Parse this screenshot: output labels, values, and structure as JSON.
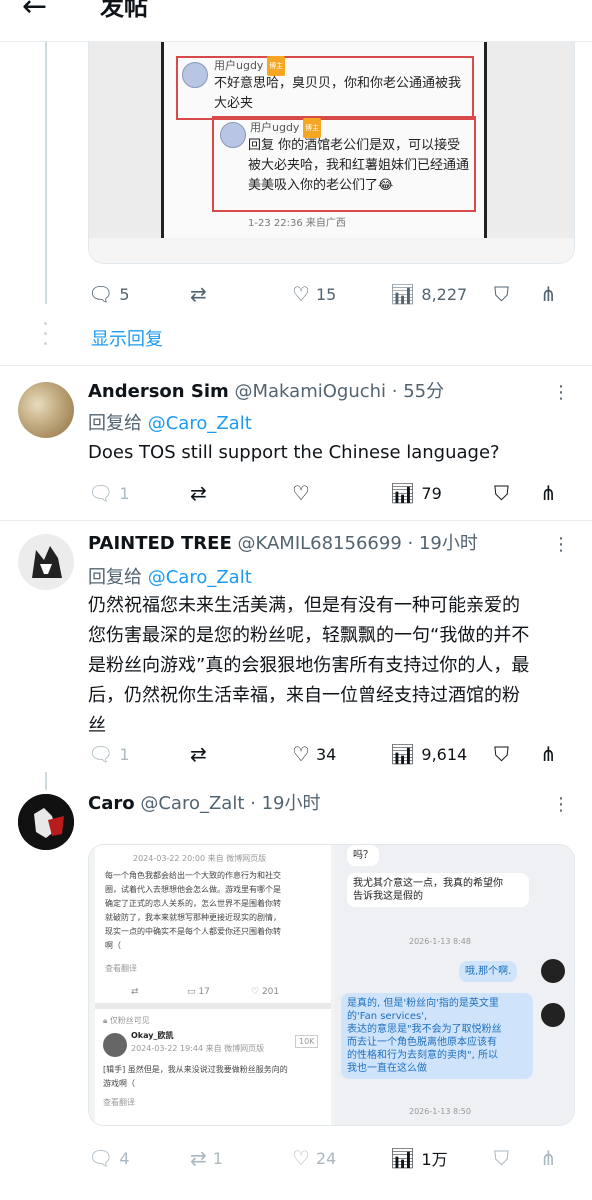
{
  "header": {
    "back_icon": "←",
    "title": "发帖"
  },
  "image1": {
    "user1": "用户ugdy",
    "badge": "博主",
    "text1": "不好意思哈，臭贝贝，你和你老公通通被我大必夹",
    "user2": "用户ugdy",
    "text2": "回复      你的酒馆老公们是双，可以接受被大必夹哈，我和红薯姐妹们已经通通美美吸入你的老公们了😂",
    "meta": "1-23 22:36 来自广西"
  },
  "tweet0_actions": {
    "replies": "5",
    "retweets": "",
    "likes": "15",
    "views": "8,227"
  },
  "show_replies": "显示回复",
  "tweets": [
    {
      "name": "Anderson Sim",
      "handle": "@MakamiOguchi",
      "time": "· 55分",
      "reply_prefix": "回复给",
      "reply_to": "@Caro_Zalt",
      "text": "Does TOS still support the Chinese language?",
      "replies": "1",
      "retweets": "",
      "likes": "",
      "views": "79"
    },
    {
      "name": "PAINTED TREE",
      "handle": "@KAMIL68156699",
      "time": "· 19小时",
      "reply_prefix": "回复给",
      "reply_to": "@Caro_Zalt",
      "text_lines": [
        "仍然祝福您未来生活美满，但是有没有一种可能亲爱的",
        "您伤害最深的是您的粉丝呢，轻飘飘的一句“我做的并不",
        "是粉丝向游戏”真的会狠狠地伤害所有支持过你的人，最",
        "后，仍然祝你生活幸福，来自一位曾经支持过酒馆的粉",
        "丝"
      ],
      "replies": "1",
      "retweets": "",
      "likes": "34",
      "views": "9,614"
    },
    {
      "name": "Caro",
      "handle": "@Caro_Zalt",
      "time": "· 19小时",
      "replies": "4",
      "retweets": "1",
      "likes": "24",
      "views": "1万"
    }
  ],
  "image2": {
    "left_ts": "2024-03-22 20:00 来自 微博网页版",
    "left_lines": [
      "每一个角色我都会给出一个大致的作息行为和社交",
      "圈，试着代入去想想他会怎么做。游戏里有哪个是",
      "确定了正式的恋人关系的，怎么世界不是围着你转",
      "就破防了，我本来就想写那种更接近现实的剧情，",
      "现实一点的中确实不是每个人都爱你还只围着你转",
      "啊（"
    ],
    "left_more": "查看翻译",
    "left_counts": {
      "forward": "",
      "comment": "17",
      "like": "201"
    },
    "fan_only": "仅粉丝可见",
    "okay_name": "Okay_欧凯",
    "okay_ts": "2024-03-22 19:44 来自 微博网页版",
    "okay_text": [
      "[辑手] 虽然但是，我从来没说过我要做粉丝服务向的",
      "游戏啊（"
    ],
    "okay_more": "查看翻译",
    "okay_follow": "10K",
    "r_q": "吗？",
    "r_bubble1": [
      "我尤其介意这一点，我真的希望你",
      "告诉我这是假的"
    ],
    "r_ts1": "2026-1-13 8:48",
    "r_bubble2": "哦,那个啊.",
    "r_bubble3": [
      "是真的, 但是'粉丝向'指的是英文里",
      "的'Fan services',",
      "表达的意思是\"我不会为了取悦粉丝",
      "而去让一个角色脱离他原本应该有",
      "的性格和行为去刻意的卖肉\", 所以",
      "我也一直在这么做"
    ],
    "r_ts2": "2026-1-13 8:50"
  },
  "colors": {
    "accent": "#1d9bf0",
    "muted": "#536471",
    "text": "#0f1419",
    "divider": "#e6ecf0"
  }
}
